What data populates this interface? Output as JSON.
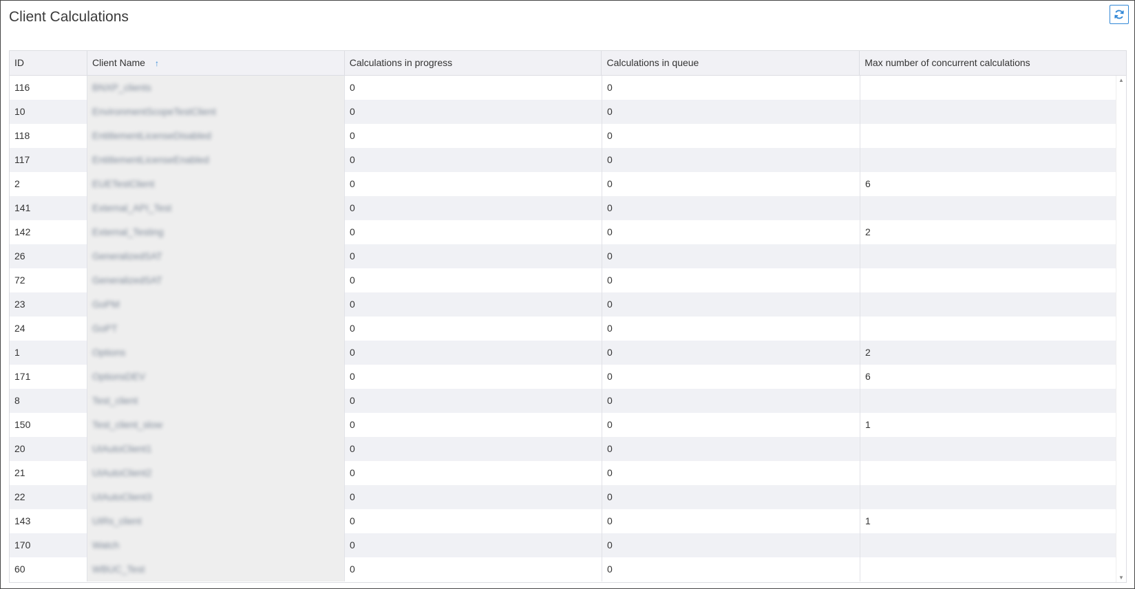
{
  "title": "Client Calculations",
  "refresh_icon": "refresh-icon",
  "accent_color": "#2f86d6",
  "table": {
    "columns": [
      "ID",
      "Client Name",
      "Calculations in progress",
      "Calculations in queue",
      "Max number of concurrent calculations"
    ],
    "sort": {
      "column": "Client Name",
      "direction": "ascending",
      "icon": "sort-ascending-icon"
    },
    "rows": [
      {
        "id": "116",
        "name": "BNXP_clients",
        "in_progress": "0",
        "in_queue": "0",
        "max": ""
      },
      {
        "id": "10",
        "name": "EnvironmentScopeTestClient",
        "in_progress": "0",
        "in_queue": "0",
        "max": ""
      },
      {
        "id": "118",
        "name": "EntitlementLicenseDisabled",
        "in_progress": "0",
        "in_queue": "0",
        "max": ""
      },
      {
        "id": "117",
        "name": "EntitlementLicenseEnabled",
        "in_progress": "0",
        "in_queue": "0",
        "max": ""
      },
      {
        "id": "2",
        "name": "EUETestClient",
        "in_progress": "0",
        "in_queue": "0",
        "max": "6"
      },
      {
        "id": "141",
        "name": "External_API_Test",
        "in_progress": "0",
        "in_queue": "0",
        "max": ""
      },
      {
        "id": "142",
        "name": "External_Testing",
        "in_progress": "0",
        "in_queue": "0",
        "max": "2"
      },
      {
        "id": "26",
        "name": "GeneralizedSAT",
        "in_progress": "0",
        "in_queue": "0",
        "max": ""
      },
      {
        "id": "72",
        "name": "GeneralizedSAT",
        "in_progress": "0",
        "in_queue": "0",
        "max": ""
      },
      {
        "id": "23",
        "name": "GoPM",
        "in_progress": "0",
        "in_queue": "0",
        "max": ""
      },
      {
        "id": "24",
        "name": "GoPT",
        "in_progress": "0",
        "in_queue": "0",
        "max": ""
      },
      {
        "id": "1",
        "name": "Options",
        "in_progress": "0",
        "in_queue": "0",
        "max": "2"
      },
      {
        "id": "171",
        "name": "OptionsDEV",
        "in_progress": "0",
        "in_queue": "0",
        "max": "6"
      },
      {
        "id": "8",
        "name": "Test_client",
        "in_progress": "0",
        "in_queue": "0",
        "max": ""
      },
      {
        "id": "150",
        "name": "Test_client_slow",
        "in_progress": "0",
        "in_queue": "0",
        "max": "1"
      },
      {
        "id": "20",
        "name": "UIAutoClient1",
        "in_progress": "0",
        "in_queue": "0",
        "max": ""
      },
      {
        "id": "21",
        "name": "UIAutoClient2",
        "in_progress": "0",
        "in_queue": "0",
        "max": ""
      },
      {
        "id": "22",
        "name": "UIAutoClient3",
        "in_progress": "0",
        "in_queue": "0",
        "max": ""
      },
      {
        "id": "143",
        "name": "UIRs_client",
        "in_progress": "0",
        "in_queue": "0",
        "max": "1"
      },
      {
        "id": "170",
        "name": "Watch",
        "in_progress": "0",
        "in_queue": "0",
        "max": ""
      },
      {
        "id": "60",
        "name": "WBUC_Test",
        "in_progress": "0",
        "in_queue": "0",
        "max": ""
      }
    ]
  }
}
